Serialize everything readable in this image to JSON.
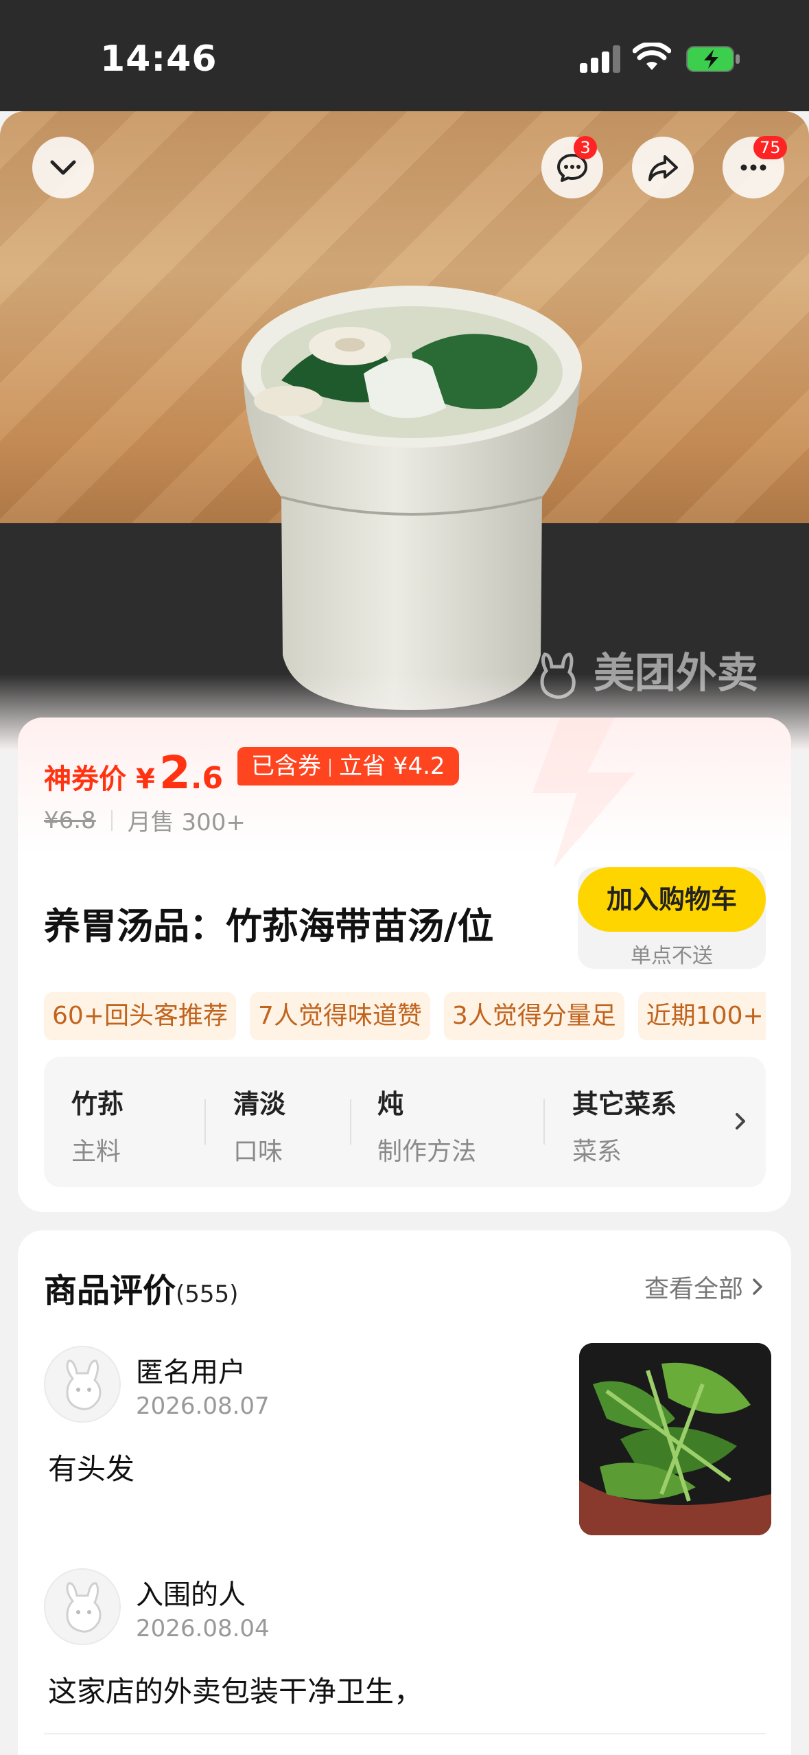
{
  "status_bar": {
    "time": "14:46"
  },
  "header": {
    "message_badge": "3",
    "more_badge": "75"
  },
  "hero": {
    "watermark": "美团外卖"
  },
  "product": {
    "price_label": "神券价",
    "currency": "¥",
    "price_int": "2",
    "price_dec": ".6",
    "coupon_included": "已含券",
    "coupon_saving": "立省 ¥4.2",
    "original_price": "¥6.8",
    "monthly_sales": "月售 300+",
    "title": "养胃汤品：竹荪海带苗汤/位",
    "cart_button": "加入购物车",
    "cart_note": "单点不送",
    "tags": [
      "60+回头客推荐",
      "7人觉得味道赞",
      "3人觉得分量足",
      "近期100+"
    ],
    "attributes": [
      {
        "value": "竹荪",
        "key": "主料"
      },
      {
        "value": "清淡",
        "key": "口味"
      },
      {
        "value": "炖",
        "key": "制作方法"
      },
      {
        "value": "其它菜系",
        "key": "菜系"
      }
    ]
  },
  "reviews": {
    "title": "商品评价",
    "count": "(555)",
    "view_all": "查看全部",
    "items": [
      {
        "user": "匿名用户",
        "date": "2026.08.07",
        "text": "有头发"
      },
      {
        "user": "入围的人",
        "date": "2026.08.04",
        "text": "这家店的外卖包装干净卫生，"
      }
    ]
  },
  "colors": {
    "accent_red": "#ff3311",
    "coupon_bg": "#ff4520",
    "cart_yellow": "#ffd500",
    "tag_bg": "#fff3e6",
    "tag_text": "#c0641d"
  }
}
